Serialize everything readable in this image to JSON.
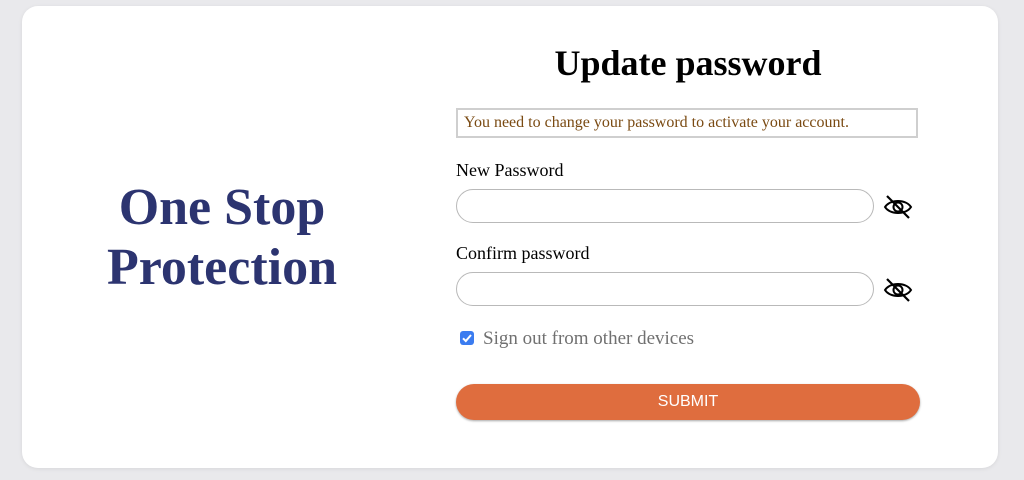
{
  "brand": {
    "line1": "One Stop",
    "line2": "Protection",
    "color": "#2c3470"
  },
  "form": {
    "title": "Update password",
    "alert": "You need to change your password to activate your account.",
    "new_password_label": "New Password",
    "new_password_value": "",
    "confirm_password_label": "Confirm password",
    "confirm_password_value": "",
    "toggle_icon": "eye-slash-icon",
    "signout_label": "Sign out from other devices",
    "signout_checked": true,
    "submit_label": "SUBMIT",
    "submit_color": "#df6d3e"
  }
}
